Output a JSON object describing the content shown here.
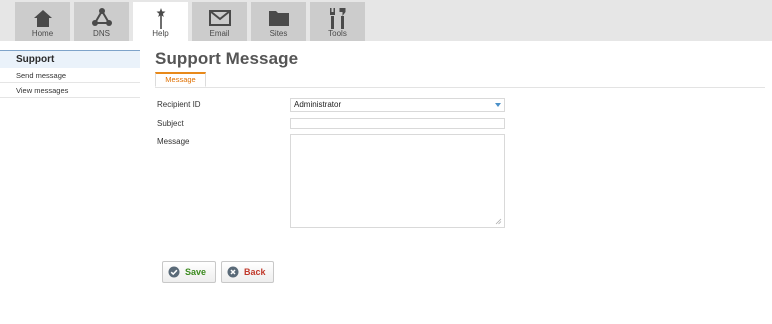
{
  "nav": {
    "tabs": [
      {
        "label": "Home",
        "icon": "home-icon"
      },
      {
        "label": "DNS",
        "icon": "dns-network-icon"
      },
      {
        "label": "Help",
        "icon": "help-wand-icon"
      },
      {
        "label": "Email",
        "icon": "email-envelope-icon"
      },
      {
        "label": "Sites",
        "icon": "sites-folder-icon"
      },
      {
        "label": "Tools",
        "icon": "tools-wrench-icon"
      }
    ],
    "active_tab": "Help"
  },
  "sidebar": {
    "heading": "Support",
    "items": [
      {
        "label": "Send message"
      },
      {
        "label": "View messages"
      }
    ]
  },
  "main": {
    "title": "Support Message",
    "subtab": "Message",
    "form": {
      "recipient_label": "Recipient ID",
      "recipient_value": "Administrator",
      "subject_label": "Subject",
      "subject_value": "",
      "message_label": "Message",
      "message_value": ""
    },
    "buttons": {
      "save_label": "Save",
      "back_label": "Back"
    }
  },
  "colors": {
    "accent_orange": "#e07000",
    "save_green": "#3b8a1e",
    "back_red": "#c0392b",
    "nav_bg": "#e6e6e6",
    "tab_bg": "#cccccc"
  }
}
